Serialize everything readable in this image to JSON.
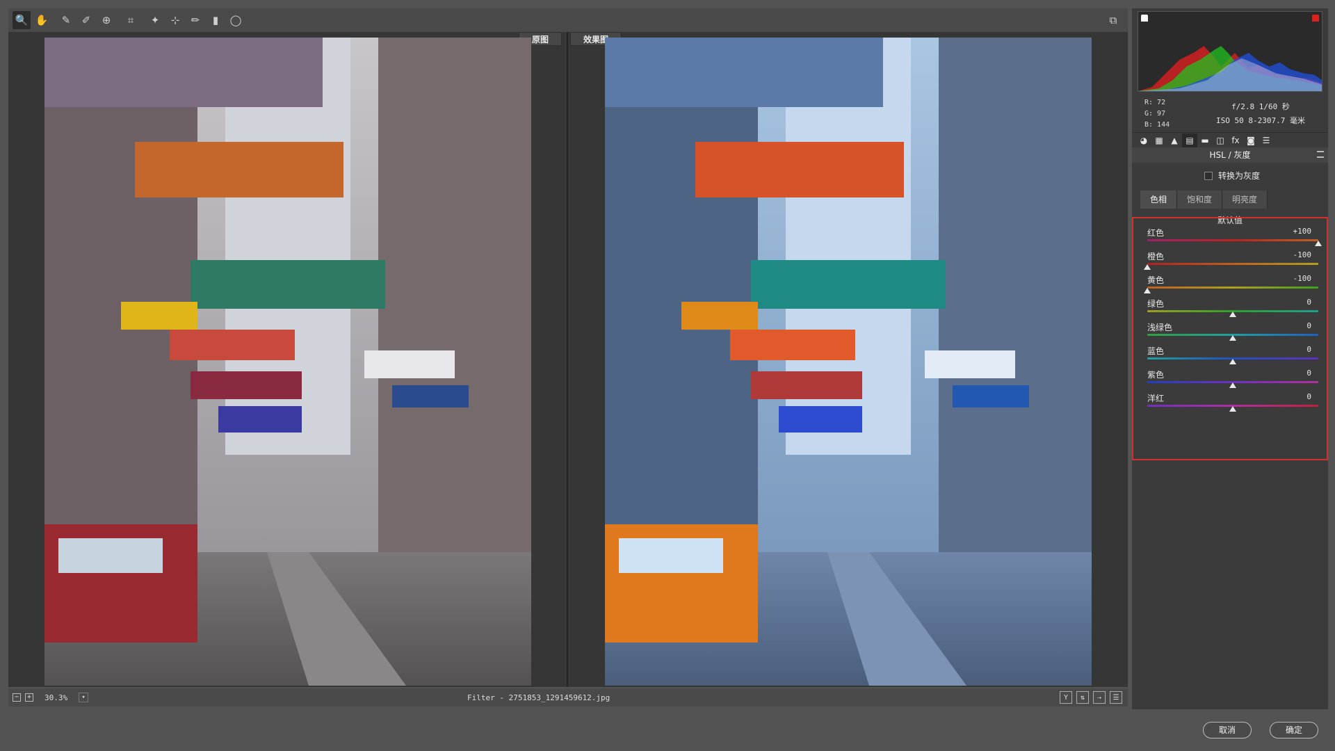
{
  "toolbar": {
    "tools": [
      {
        "icon": "zoom-icon",
        "glyph": "🔍"
      },
      {
        "icon": "hand-icon",
        "glyph": "✋"
      },
      {
        "icon": "white-balance-icon",
        "glyph": "✎"
      },
      {
        "icon": "color-sampler-icon",
        "glyph": "✐"
      },
      {
        "icon": "target-adjust-icon",
        "glyph": "⊕"
      },
      {
        "icon": "crop-icon",
        "glyph": "⌗"
      },
      {
        "icon": "spot-removal-icon",
        "glyph": "✦"
      },
      {
        "icon": "red-eye-icon",
        "glyph": "⊹"
      },
      {
        "icon": "adjustment-brush-icon",
        "glyph": "✏"
      },
      {
        "icon": "graduated-filter-icon",
        "glyph": "▮"
      },
      {
        "icon": "radial-filter-icon",
        "glyph": "◯"
      }
    ],
    "fullscreen_icon": "fullscreen-icon"
  },
  "view": {
    "before_label": "原图",
    "after_label": "效果图"
  },
  "status": {
    "zoom": "30.3%",
    "filename": "Filter -  2751853_1291459612.jpg"
  },
  "histogram": {
    "rgb": "R:  72\nG:  97\nB:  144",
    "r": "R:  72",
    "g": "G:  97",
    "b": "B:  144",
    "exif_line1": "f/2.8  1/60 秒",
    "exif_line2": "ISO 50  8-2307.7 毫米"
  },
  "panel": {
    "title": "HSL / 灰度",
    "grayscale_label": "转换为灰度",
    "tabs": [
      "色相",
      "饱和度",
      "明亮度"
    ],
    "defaults_label": "默认值",
    "sliders": [
      {
        "label": "红色",
        "value": "+100",
        "pos": 1.0,
        "gradient": "linear-gradient(90deg,#a0206a,#c02020,#c06020)"
      },
      {
        "label": "橙色",
        "value": "-100",
        "pos": 0.0,
        "gradient": "linear-gradient(90deg,#b02020,#c06020,#b0a020)"
      },
      {
        "label": "黄色",
        "value": "-100",
        "pos": 0.0,
        "gradient": "linear-gradient(90deg,#c06020,#b0a020,#40a020)"
      },
      {
        "label": "绿色",
        "value": "0",
        "pos": 0.5,
        "gradient": "linear-gradient(90deg,#a0a020,#30a030,#20a090)"
      },
      {
        "label": "浅绿色",
        "value": "0",
        "pos": 0.5,
        "gradient": "linear-gradient(90deg,#30a040,#20a0a0,#2060c0)"
      },
      {
        "label": "蓝色",
        "value": "0",
        "pos": 0.5,
        "gradient": "linear-gradient(90deg,#20a0a0,#2050c0,#6030c0)"
      },
      {
        "label": "紫色",
        "value": "0",
        "pos": 0.5,
        "gradient": "linear-gradient(90deg,#2040c0,#7030c0,#b030a0)"
      },
      {
        "label": "洋红",
        "value": "0",
        "pos": 0.5,
        "gradient": "linear-gradient(90deg,#7030c0,#b030a0,#c02040)"
      }
    ]
  },
  "footer": {
    "cancel_label": "取消",
    "ok_label": "确定"
  },
  "colors": {
    "accent_highlight": "#d32f2f",
    "panel_bg": "#3b3b3b"
  }
}
